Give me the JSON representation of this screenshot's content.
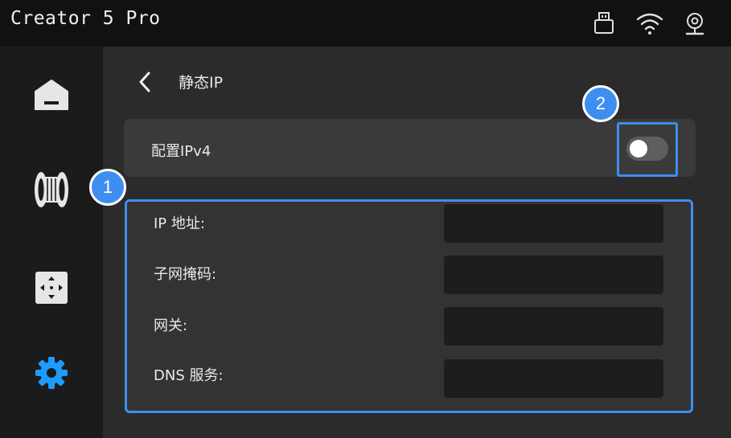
{
  "app": {
    "title": "Creator 5 Pro"
  },
  "status_icons": [
    "usb-drive-icon",
    "wifi-icon",
    "webcam-icon"
  ],
  "sidebar": {
    "items": [
      {
        "name": "home",
        "icon": "home-icon"
      },
      {
        "name": "filament",
        "icon": "filament-spool-icon"
      },
      {
        "name": "move",
        "icon": "move-axes-icon"
      },
      {
        "name": "settings",
        "icon": "gear-icon",
        "active": true
      }
    ]
  },
  "page": {
    "title": "静态IP",
    "back_icon": "chevron-left-icon"
  },
  "ipv4": {
    "label": "配置IPv4",
    "enabled": false
  },
  "fields": [
    {
      "label": "IP 地址:",
      "value": ""
    },
    {
      "label": "子网掩码:",
      "value": ""
    },
    {
      "label": "网关:",
      "value": ""
    },
    {
      "label": "DNS 服务:",
      "value": ""
    }
  ],
  "callouts": [
    "1",
    "2"
  ],
  "colors": {
    "accent": "#3e8ef0",
    "topbar_bg": "#111111",
    "sidebar_bg": "#1b1b1b",
    "panel_bg": "#2b2b2b",
    "row_bg": "#3a3a3a",
    "input_bg": "#1d1d1d",
    "active_icon": "#1e9bff"
  }
}
